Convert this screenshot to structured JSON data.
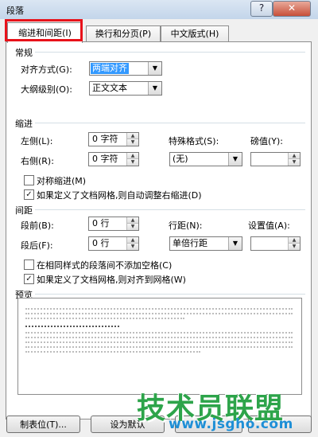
{
  "window": {
    "title": "段落",
    "help": "?",
    "close": "✕"
  },
  "tabs": [
    {
      "label": "缩进和间距(I)"
    },
    {
      "label": "换行和分页(P)"
    },
    {
      "label": "中文版式(H)"
    }
  ],
  "general": {
    "heading": "常规",
    "alignment_label": "对齐方式(G):",
    "alignment_value": "两端对齐",
    "outline_label": "大纲级别(O):",
    "outline_value": "正文文本"
  },
  "indent": {
    "heading": "缩进",
    "left_label": "左侧(L):",
    "left_value": "0 字符",
    "right_label": "右侧(R):",
    "right_value": "0 字符",
    "special_label": "特殊格式(S):",
    "special_value": "(无)",
    "by_label": "磅值(Y):",
    "by_value": "",
    "mirror_label": "对称缩进(M)",
    "mirror_checked": false,
    "auto_adjust_label": "如果定义了文档网格,则自动调整右缩进(D)",
    "auto_adjust_checked": true
  },
  "spacing": {
    "heading": "间距",
    "before_label": "段前(B):",
    "before_value": "0 行",
    "after_label": "段后(F):",
    "after_value": "0 行",
    "line_label": "行距(N):",
    "line_value": "单倍行距",
    "at_label": "设置值(A):",
    "at_value": "",
    "no_space_label": "在相同样式的段落间不添加空格(C)",
    "no_space_checked": false,
    "snap_grid_label": "如果定义了文档网格,则对齐到网格(W)",
    "snap_grid_checked": true
  },
  "preview": {
    "heading": "预览"
  },
  "buttons": {
    "tabs": "制表位(T)...",
    "set_default": "设为默认"
  },
  "watermark": {
    "brand": "技术员联盟",
    "url": "www.jsgho.com"
  },
  "icons": {
    "checkmark": "✓",
    "dropdown": "▼",
    "spin_up": "▲",
    "spin_down": "▼"
  }
}
